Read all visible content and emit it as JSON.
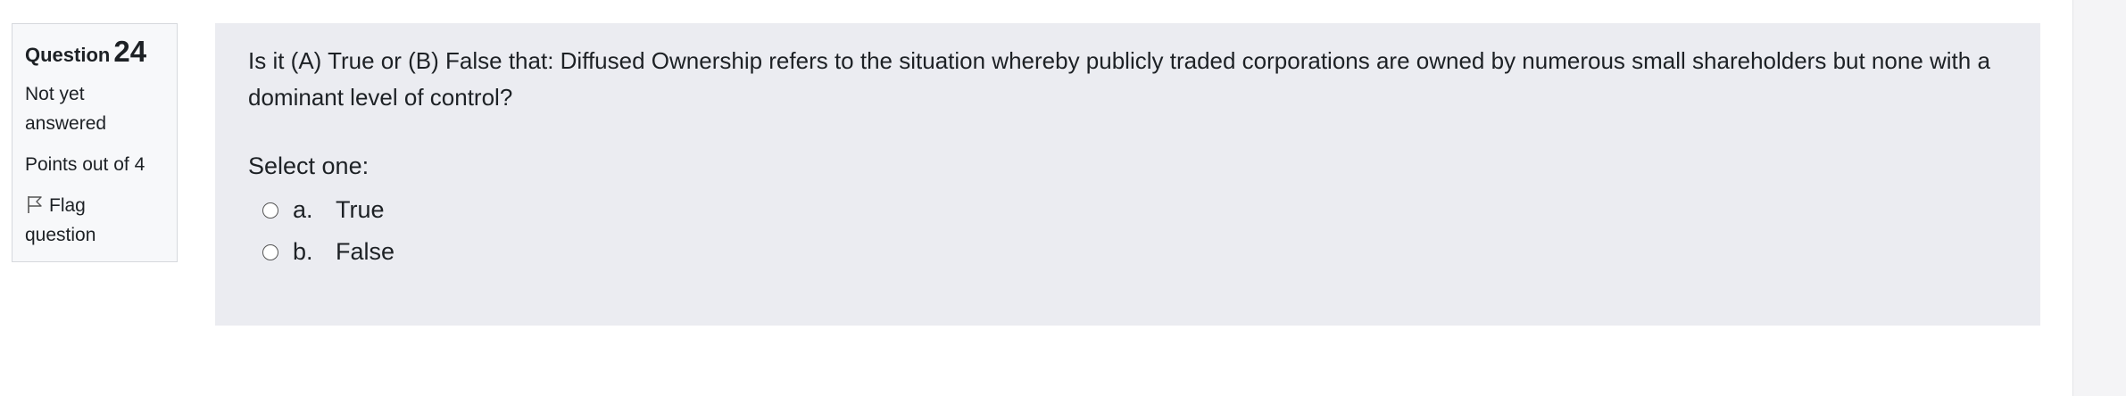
{
  "question_info": {
    "label": "Question",
    "number": "24",
    "state": "Not yet answered",
    "grade": "Points out of 4",
    "flag_label": "Flag question",
    "flag_icon": "flag-icon"
  },
  "question": {
    "text": "Is it (A) True or (B) False that: Diffused Ownership refers to the situation whereby publicly traded corporations are owned by numerous small shareholders but none with a dominant level of control?",
    "prompt": "Select one:",
    "answers": [
      {
        "number": "a.",
        "label": "True"
      },
      {
        "number": "b.",
        "label": "False"
      }
    ]
  },
  "colors": {
    "content_background": "#ebecf1",
    "info_background": "#f7f8fa",
    "text": "#1d2125"
  }
}
